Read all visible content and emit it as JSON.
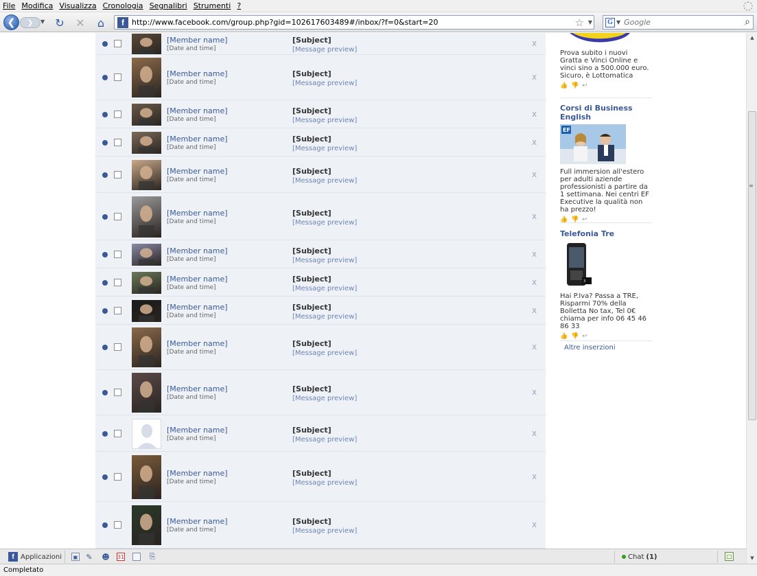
{
  "menu": [
    "File",
    "Modifica",
    "Visualizza",
    "Cronologia",
    "Segnalibri",
    "Strumenti",
    "?"
  ],
  "url": "http://www.facebook.com/group.php?gid=102617603489#/inbox/?f=0&start=20",
  "search": {
    "placeholder": "Google"
  },
  "inbox": {
    "messages": [
      {
        "sender": "[Member name]",
        "date": "[Date and time]",
        "subject": "[Subject]",
        "preview": "[Message preview]",
        "unread": true,
        "photo": "photo"
      },
      {
        "sender": "[Member name]",
        "date": "[Date and time]",
        "subject": "[Subject]",
        "preview": "[Message preview]",
        "unread": true,
        "photo": "photo"
      },
      {
        "sender": "[Member name]",
        "date": "[Date and time]",
        "subject": "[Subject]",
        "preview": "[Message preview]",
        "unread": true,
        "photo": "photo"
      },
      {
        "sender": "[Member name]",
        "date": "[Date and time]",
        "subject": "[Subject]",
        "preview": "[Message preview]",
        "unread": true,
        "photo": "photo"
      },
      {
        "sender": "[Member name]",
        "date": "[Date and time]",
        "subject": "[Subject]",
        "preview": "[Message preview]",
        "unread": true,
        "photo": "photo"
      },
      {
        "sender": "[Member name]",
        "date": "[Date and time]",
        "subject": "[Subject]",
        "preview": "[Message preview]",
        "unread": true,
        "photo": "photo"
      },
      {
        "sender": "[Member name]",
        "date": "[Date and time]",
        "subject": "[Subject]",
        "preview": "[Message preview]",
        "unread": true,
        "photo": "photo"
      },
      {
        "sender": "[Member name]",
        "date": "[Date and time]",
        "subject": "[Subject]",
        "preview": "[Message preview]",
        "unread": true,
        "photo": "photo"
      },
      {
        "sender": "[Member name]",
        "date": "[Date and time]",
        "subject": "[Subject]",
        "preview": "[Message preview]",
        "unread": true,
        "photo": "photo"
      },
      {
        "sender": "[Member name]",
        "date": "[Date and time]",
        "subject": "[Subject]",
        "preview": "[Message preview]",
        "unread": true,
        "photo": "photo"
      },
      {
        "sender": "[Member name]",
        "date": "[Date and time]",
        "subject": "[Subject]",
        "preview": "[Message preview]",
        "unread": true,
        "photo": "photo"
      },
      {
        "sender": "[Member name]",
        "date": "[Date and time]",
        "subject": "[Subject]",
        "preview": "[Message preview]",
        "unread": true,
        "photo": "default-avatar"
      },
      {
        "sender": "[Member name]",
        "date": "[Date and time]",
        "subject": "[Subject]",
        "preview": "[Message preview]",
        "unread": true,
        "photo": "photo"
      },
      {
        "sender": "[Member name]",
        "date": "[Date and time]",
        "subject": "[Subject]",
        "preview": "[Message preview]",
        "unread": true,
        "photo": "photo"
      }
    ],
    "delete_label": "x"
  },
  "ads": [
    {
      "title": "",
      "body": "Prova subito i nuovi Gratta e Vinci Online e vinci sino a 500.000 euro. Sicuro, è Lottomatica",
      "like": "👍 👎 ↩"
    },
    {
      "title": "Corsi di Business English",
      "body": "Full immersion all'estero per adulti aziende professionisti a partire da 1 settimana. Nei centri EF Executive la qualità non ha prezzo!",
      "like": "👍 👎 ↩"
    },
    {
      "title": "Telefonia Tre",
      "body": "Hai P.Iva? Passa a TRE, Risparmi 70% della Bolletta No tax, Tel 0€ chiama per info 06 45 46 86 33",
      "like": "👍 👎 ↩"
    }
  ],
  "more_ads": "Altre inserzioni",
  "bottom_bar": {
    "applications": "Applicazioni",
    "chat_label": "Chat",
    "chat_count": "(1)"
  },
  "status": "Completato",
  "colors": {
    "fb_blue": "#3b5998",
    "link_blue": "#6d84b4",
    "inbox_bg": "#eef2f7"
  },
  "icons": [
    "back-icon",
    "forward-icon",
    "reload-icon",
    "stop-icon",
    "home-icon",
    "bookmark-star-icon",
    "search-icon",
    "chat-icon"
  ]
}
